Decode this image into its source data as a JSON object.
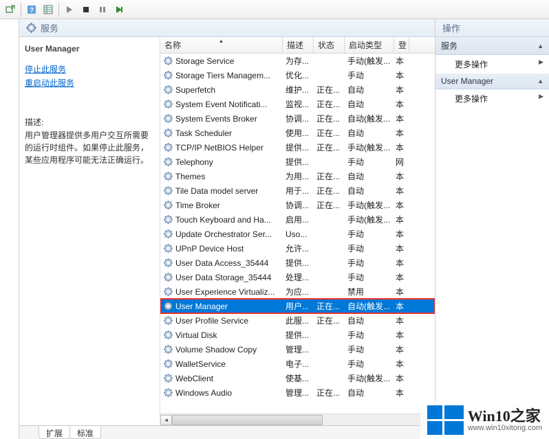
{
  "toolbar": {
    "icons": [
      "export-icon",
      "help-icon",
      "detail-icon",
      "play-icon",
      "stop-icon",
      "pause-icon",
      "restart-icon"
    ]
  },
  "center": {
    "header": "服务",
    "detail": {
      "title": "User Manager",
      "link_stop": "停止此服务",
      "link_restart": "重启动此服务",
      "desc_label": "描述:",
      "desc_text": "用户管理器提供多用户交互所需要的运行时组件。如果停止此服务，某些应用程序可能无法正确运行。"
    },
    "columns": {
      "name": "名称",
      "desc": "描述",
      "status": "状态",
      "startup": "启动类型",
      "logon": "登"
    },
    "rows": [
      {
        "name": "Storage Service",
        "desc": "为存...",
        "status": "",
        "startup": "手动(触发...",
        "logon": "本"
      },
      {
        "name": "Storage Tiers Managem...",
        "desc": "优化...",
        "status": "",
        "startup": "手动",
        "logon": "本"
      },
      {
        "name": "Superfetch",
        "desc": "维护...",
        "status": "正在...",
        "startup": "自动",
        "logon": "本"
      },
      {
        "name": "System Event Notificati...",
        "desc": "监视...",
        "status": "正在...",
        "startup": "自动",
        "logon": "本"
      },
      {
        "name": "System Events Broker",
        "desc": "协调...",
        "status": "正在...",
        "startup": "自动(触发...",
        "logon": "本"
      },
      {
        "name": "Task Scheduler",
        "desc": "使用...",
        "status": "正在...",
        "startup": "自动",
        "logon": "本"
      },
      {
        "name": "TCP/IP NetBIOS Helper",
        "desc": "提供...",
        "status": "正在...",
        "startup": "手动(触发...",
        "logon": "本"
      },
      {
        "name": "Telephony",
        "desc": "提供...",
        "status": "",
        "startup": "手动",
        "logon": "网"
      },
      {
        "name": "Themes",
        "desc": "为用...",
        "status": "正在...",
        "startup": "自动",
        "logon": "本"
      },
      {
        "name": "Tile Data model server",
        "desc": "用于...",
        "status": "正在...",
        "startup": "自动",
        "logon": "本"
      },
      {
        "name": "Time Broker",
        "desc": "协调...",
        "status": "正在...",
        "startup": "手动(触发...",
        "logon": "本"
      },
      {
        "name": "Touch Keyboard and Ha...",
        "desc": "启用...",
        "status": "",
        "startup": "手动(触发...",
        "logon": "本"
      },
      {
        "name": "Update Orchestrator Ser...",
        "desc": "Uso...",
        "status": "",
        "startup": "手动",
        "logon": "本"
      },
      {
        "name": "UPnP Device Host",
        "desc": "允许...",
        "status": "",
        "startup": "手动",
        "logon": "本"
      },
      {
        "name": "User Data Access_35444",
        "desc": "提供...",
        "status": "",
        "startup": "手动",
        "logon": "本"
      },
      {
        "name": "User Data Storage_35444",
        "desc": "处理...",
        "status": "",
        "startup": "手动",
        "logon": "本"
      },
      {
        "name": "User Experience Virtualiz...",
        "desc": "为应...",
        "status": "",
        "startup": "禁用",
        "logon": "本"
      },
      {
        "name": "User Manager",
        "desc": "用户...",
        "status": "正在...",
        "startup": "自动(触发...",
        "logon": "本",
        "selected": true,
        "highlighted": true
      },
      {
        "name": "User Profile Service",
        "desc": "此服...",
        "status": "正在...",
        "startup": "自动",
        "logon": "本"
      },
      {
        "name": "Virtual Disk",
        "desc": "提供...",
        "status": "",
        "startup": "手动",
        "logon": "本"
      },
      {
        "name": "Volume Shadow Copy",
        "desc": "管理...",
        "status": "",
        "startup": "手动",
        "logon": "本"
      },
      {
        "name": "WalletService",
        "desc": "电子...",
        "status": "",
        "startup": "手动",
        "logon": "本"
      },
      {
        "name": "WebClient",
        "desc": "使基...",
        "status": "",
        "startup": "手动(触发...",
        "logon": "本"
      },
      {
        "name": "Windows Audio",
        "desc": "管理...",
        "status": "正在...",
        "startup": "自动",
        "logon": "本"
      }
    ],
    "tabs": {
      "extended": "扩展",
      "standard": "标准"
    }
  },
  "actions": {
    "header": "操作",
    "section1": "服务",
    "item1": "更多操作",
    "section2": "User Manager",
    "item2": "更多操作"
  },
  "watermark": {
    "title": "Win10之家",
    "url": "www.win10xitong.com"
  }
}
